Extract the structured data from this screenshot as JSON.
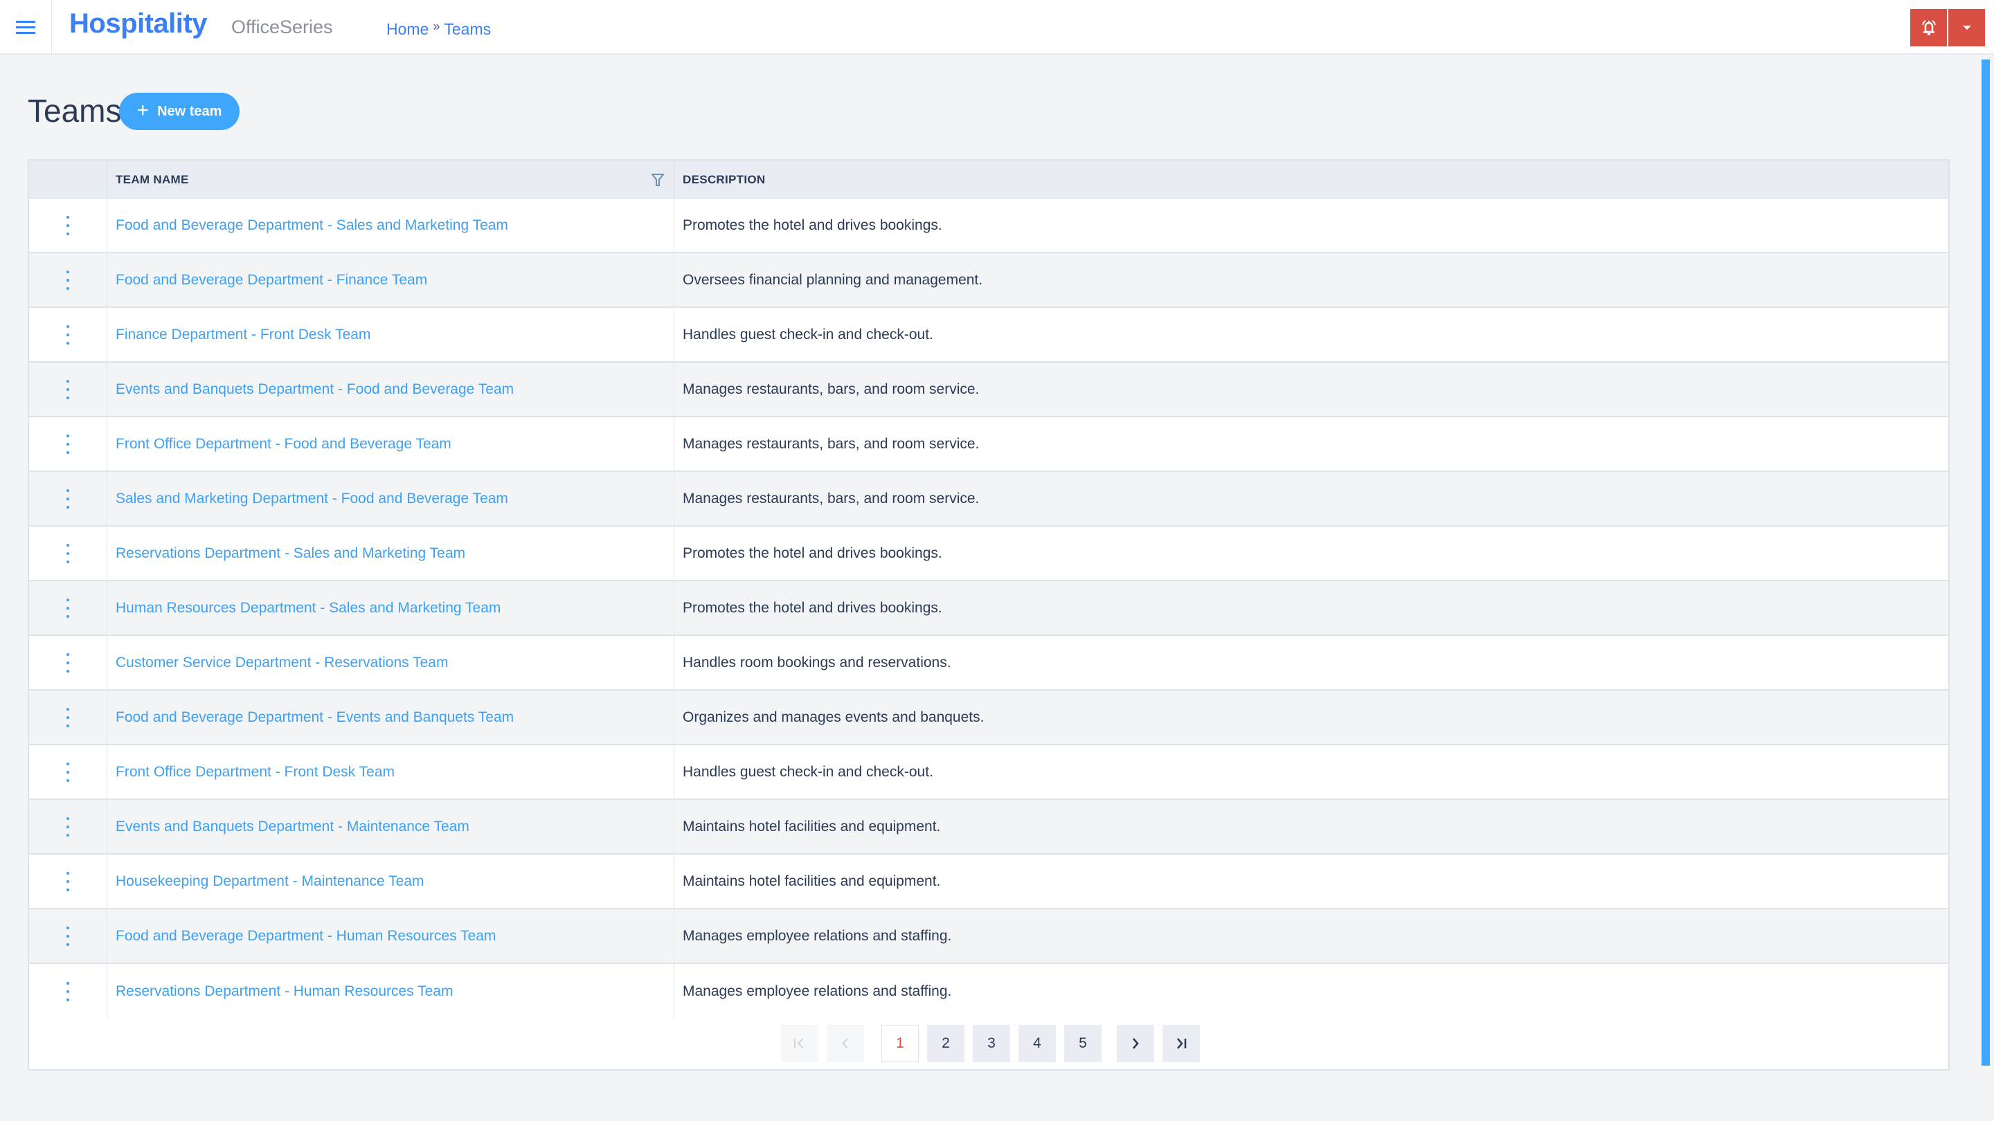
{
  "header": {
    "brand": "Hospitality",
    "product": "OfficeSeries",
    "breadcrumb": [
      {
        "label": "Home"
      },
      {
        "label": "Teams"
      }
    ],
    "breadcrumb_separator": "»",
    "icons": {
      "menu": "hamburger-icon",
      "alert": "bell-ring-icon",
      "dropdown": "caret-down-icon"
    },
    "accent_color": "#3b7ff5",
    "alert_color": "#d94f43"
  },
  "page": {
    "title": "Teams",
    "new_button_label": "New team",
    "new_button_icon": "plus-icon"
  },
  "table": {
    "columns": [
      {
        "label": ""
      },
      {
        "label": "TEAM NAME",
        "filter_icon": "filter-icon"
      },
      {
        "label": "DESCRIPTION"
      }
    ],
    "rows": [
      {
        "name": "Food and Beverage Department - Sales and Marketing Team",
        "description": "Promotes the hotel and drives bookings."
      },
      {
        "name": "Food and Beverage Department - Finance Team",
        "description": "Oversees financial planning and management."
      },
      {
        "name": "Finance Department - Front Desk Team",
        "description": "Handles guest check-in and check-out."
      },
      {
        "name": "Events and Banquets Department - Food and Beverage Team",
        "description": "Manages restaurants, bars, and room service."
      },
      {
        "name": "Front Office Department - Food and Beverage Team",
        "description": "Manages restaurants, bars, and room service."
      },
      {
        "name": "Sales and Marketing Department - Food and Beverage Team",
        "description": "Manages restaurants, bars, and room service."
      },
      {
        "name": "Reservations Department - Sales and Marketing Team",
        "description": "Promotes the hotel and drives bookings."
      },
      {
        "name": "Human Resources Department - Sales and Marketing Team",
        "description": "Promotes the hotel and drives bookings."
      },
      {
        "name": "Customer Service Department - Reservations Team",
        "description": "Handles room bookings and reservations."
      },
      {
        "name": "Food and Beverage Department - Events and Banquets Team",
        "description": "Organizes and manages events and banquets."
      },
      {
        "name": "Front Office Department - Front Desk Team",
        "description": "Handles guest check-in and check-out."
      },
      {
        "name": "Events and Banquets Department - Maintenance Team",
        "description": "Maintains hotel facilities and equipment."
      },
      {
        "name": "Housekeeping Department - Maintenance Team",
        "description": "Maintains hotel facilities and equipment."
      },
      {
        "name": "Food and Beverage Department - Human Resources Team",
        "description": "Manages employee relations and staffing."
      },
      {
        "name": "Reservations Department - Human Resources Team",
        "description": "Manages employee relations and staffing."
      }
    ],
    "row_action_icon": "kebab-menu-icon"
  },
  "pagination": {
    "first": "|<",
    "prev": "<",
    "pages": [
      "1",
      "2",
      "3",
      "4",
      "5"
    ],
    "current_page": "1",
    "next": ">",
    "last": ">|"
  }
}
